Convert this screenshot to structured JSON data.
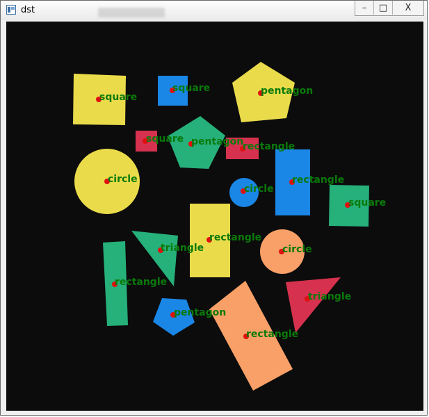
{
  "window": {
    "title": "dst",
    "controls": {
      "minimize": "–",
      "maximize": "□",
      "close": "X"
    }
  },
  "labels": {
    "square": "square",
    "pentagon": "pentagon",
    "rectangle": "rectangle",
    "circle": "circle",
    "triangle": "triangle"
  },
  "colors": {
    "background": "#0c0c0c",
    "yellow": "#eadb4a",
    "blue": "#1a86e6",
    "green": "#26b07a",
    "red": "#d6324f",
    "orange": "#f8a067",
    "label": "#0a7a0a",
    "centroid": "#e01010"
  }
}
